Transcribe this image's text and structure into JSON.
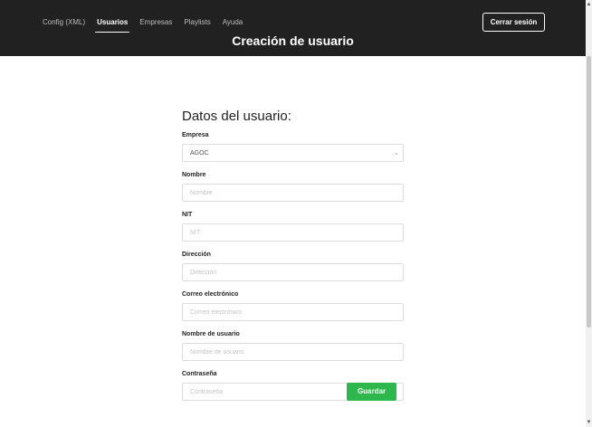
{
  "nav": {
    "items": [
      {
        "label": "Config (XML)",
        "active": false
      },
      {
        "label": "Usuarios",
        "active": true
      },
      {
        "label": "Empresas",
        "active": false
      },
      {
        "label": "Playlists",
        "active": false
      },
      {
        "label": "Ayuda",
        "active": false
      }
    ]
  },
  "header": {
    "title": "Creación de usuario",
    "logout_label": "Cerrar sesión"
  },
  "form": {
    "heading": "Datos del usuario:",
    "empresa": {
      "label": "Empresa",
      "value": "AGOC",
      "icon": "chevron-down-icon"
    },
    "nombre": {
      "label": "Nombre",
      "placeholder": "Nombre"
    },
    "nit": {
      "label": "NIT",
      "placeholder": "NIT"
    },
    "direccion": {
      "label": "Dirección",
      "placeholder": "Dirección"
    },
    "correo": {
      "label": "Correo electrónico",
      "placeholder": "Correo electrónico"
    },
    "usuario": {
      "label": "Nombre de usuario",
      "placeholder": "Nombre de usuario"
    },
    "contrasena": {
      "label": "Contraseña",
      "placeholder": "Contraseña"
    },
    "save_label": "Guardar"
  },
  "colors": {
    "topbar": "#212121",
    "save_button": "#2db74c"
  }
}
